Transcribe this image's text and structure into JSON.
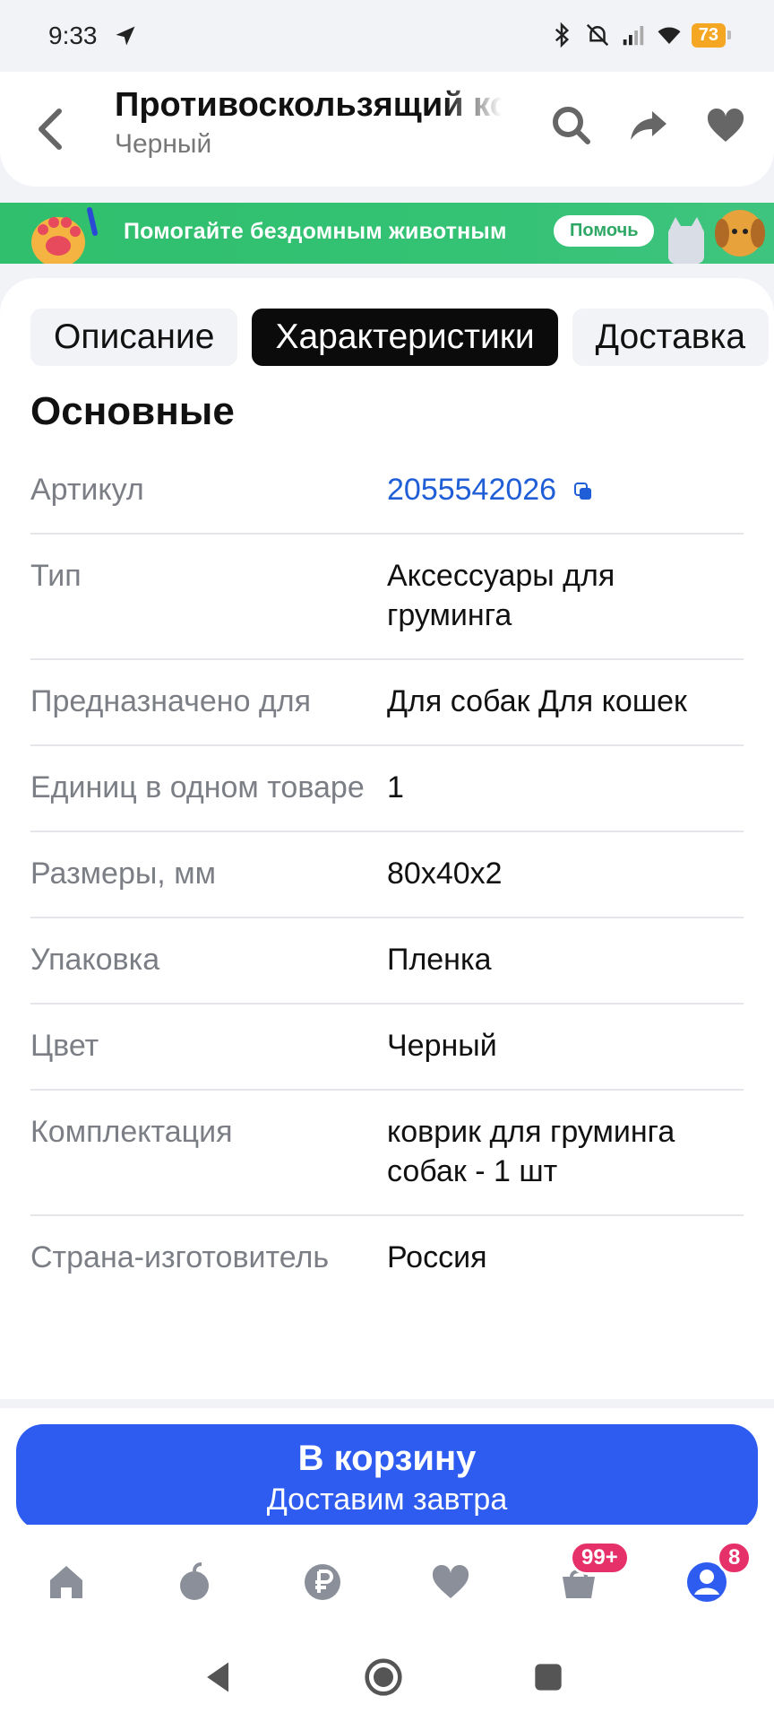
{
  "status_bar": {
    "time": "9:33",
    "battery": "73",
    "icons": [
      "navigation-icon",
      "bluetooth-icon",
      "mute-icon",
      "signal-icon",
      "wifi-icon"
    ]
  },
  "header": {
    "title": "Противоскользящий коврик",
    "subtitle": "Черный",
    "actions": [
      "search-icon",
      "share-icon",
      "heart-icon"
    ]
  },
  "banner": {
    "text": "Помогайте бездомным животным",
    "button": "Помочь"
  },
  "tabs": [
    {
      "label": "Описание",
      "active": false
    },
    {
      "label": "Характеристики",
      "active": true
    },
    {
      "label": "Доставка",
      "active": false
    }
  ],
  "section": {
    "title": "Основные",
    "rows": [
      {
        "key": "Артикул",
        "value": "2055542026"
      },
      {
        "key": "Тип",
        "value": "Аксессуары для груминга"
      },
      {
        "key": "Предназначено для",
        "value": "Для собак Для кошек"
      },
      {
        "key": "Единиц в одном товаре",
        "value": "1"
      },
      {
        "key": "Размеры, мм",
        "value": "80x40x2"
      },
      {
        "key": "Упаковка",
        "value": "Пленка"
      },
      {
        "key": "Цвет",
        "value": "Черный"
      },
      {
        "key": "Комплектация",
        "value": "коврик для груминга собак - 1 шт"
      },
      {
        "key": "Страна-изготовитель",
        "value": "Россия"
      }
    ]
  },
  "cart": {
    "label": "В корзину",
    "sublabel": "Доставим завтра"
  },
  "bottom_nav": {
    "items": [
      "home-icon",
      "catalog-icon",
      "payment-icon",
      "favorites-icon",
      "cart-icon",
      "profile-icon"
    ],
    "cart_badge": "99+",
    "profile_badge": "8"
  },
  "colors": {
    "accent": "#2f5cf0",
    "link": "#1f5ed6",
    "badge": "#e6306a",
    "banner": "#34c274"
  }
}
